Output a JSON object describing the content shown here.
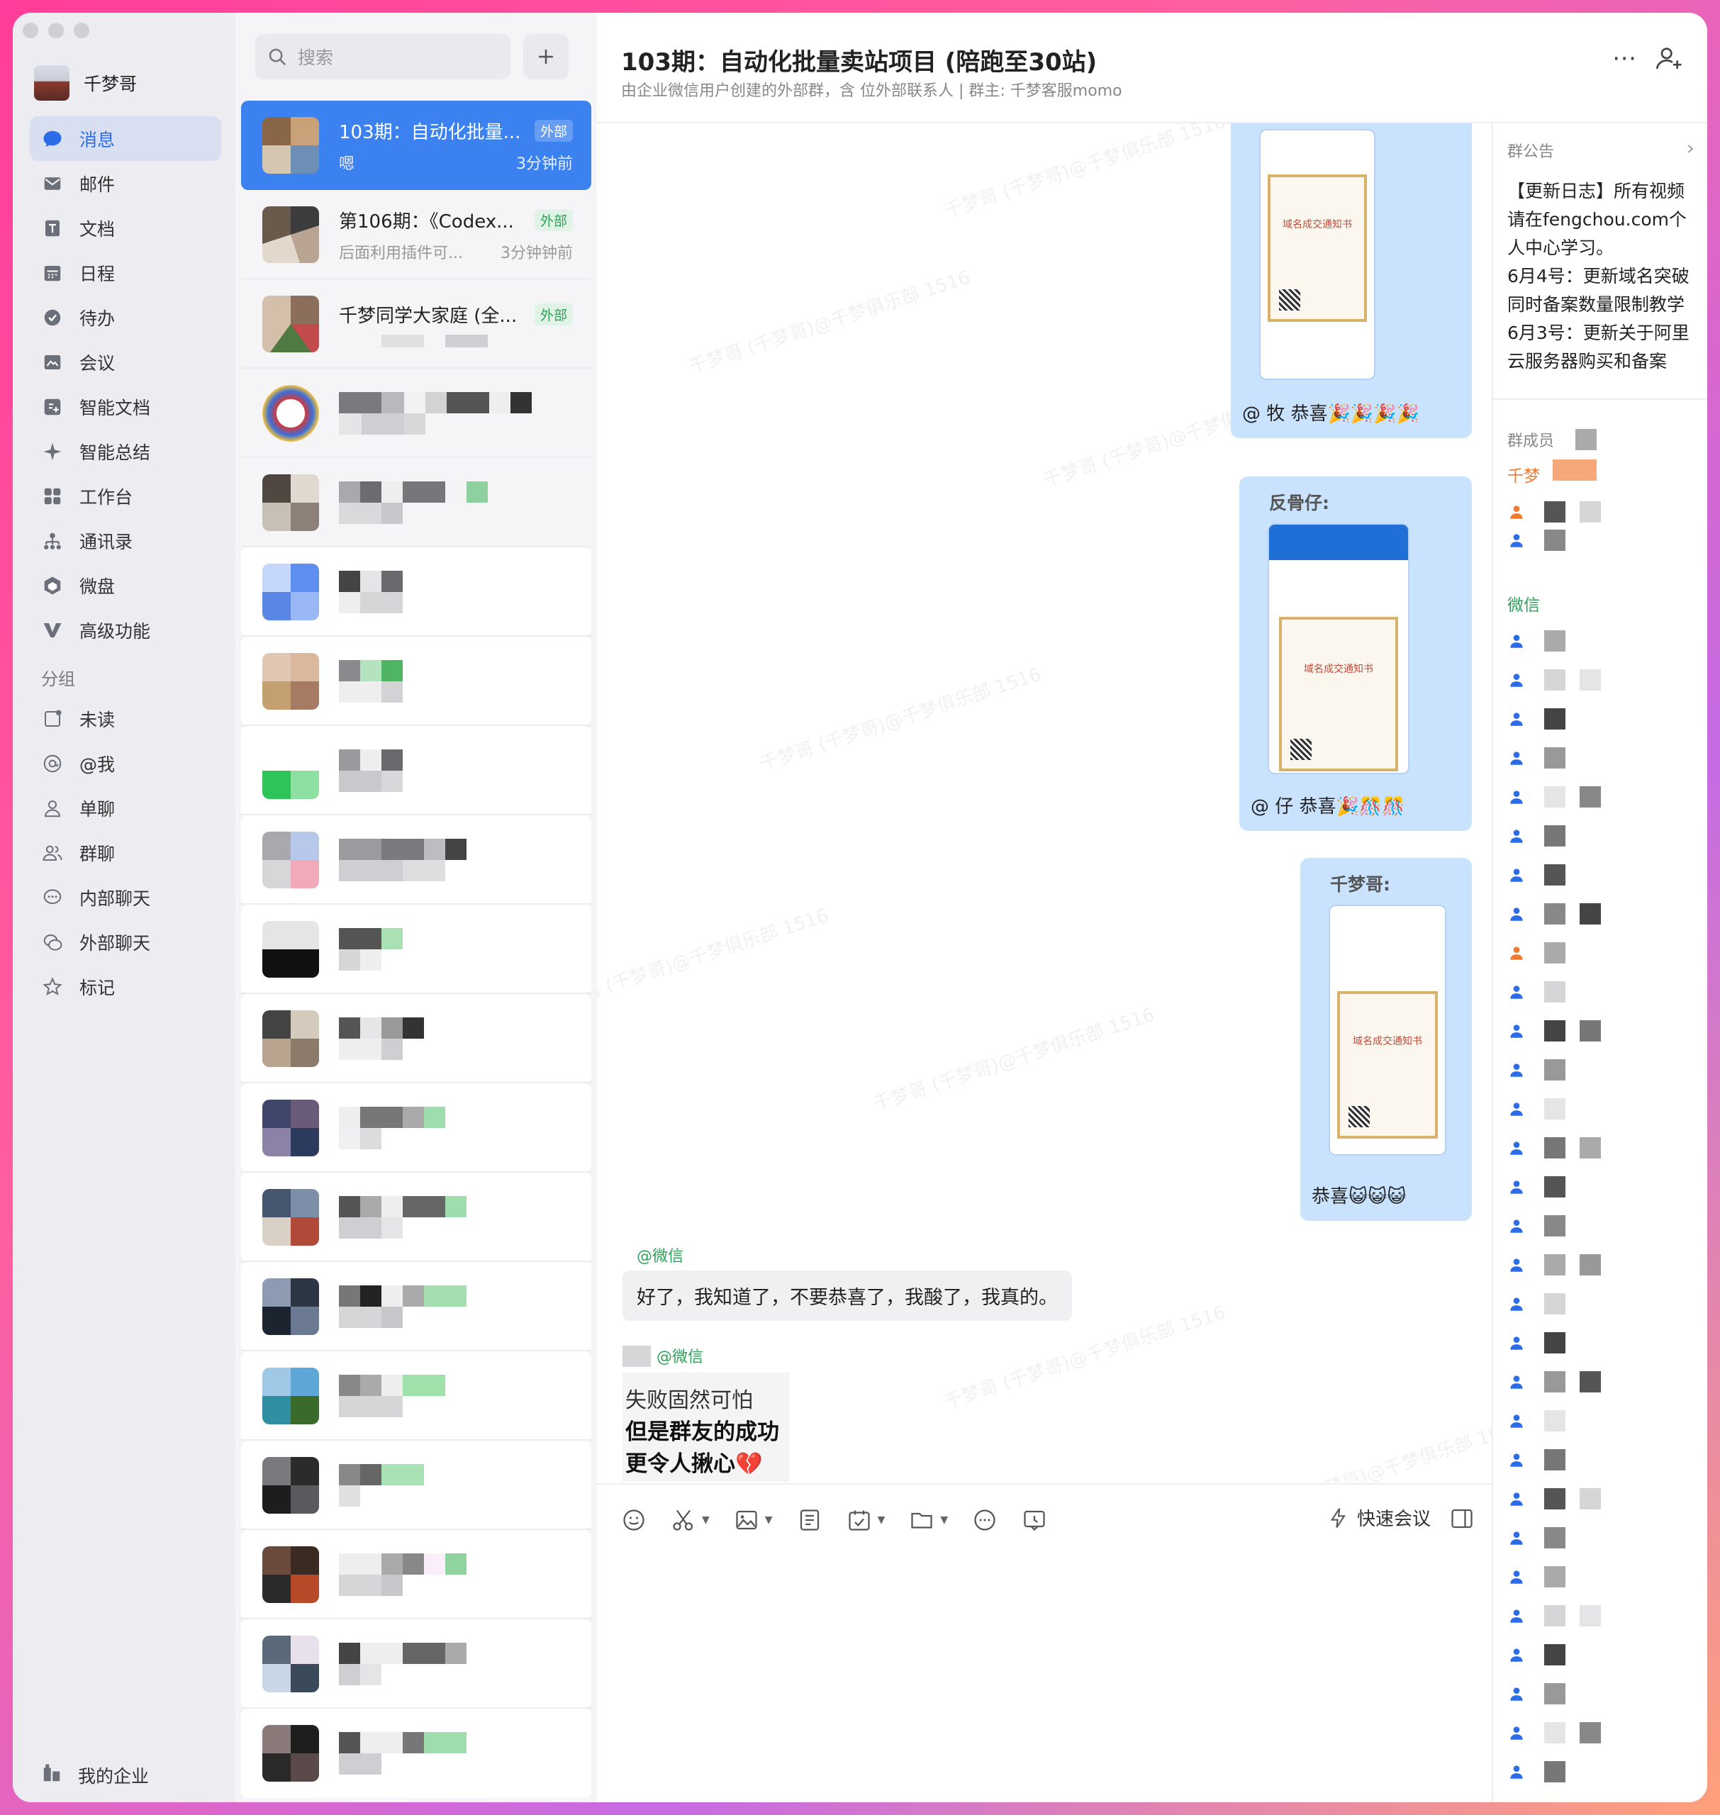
{
  "user": {
    "name": "千梦哥"
  },
  "nav": {
    "items": [
      {
        "label": "消息",
        "icon": "message-icon",
        "active": true
      },
      {
        "label": "邮件",
        "icon": "mail-icon"
      },
      {
        "label": "文档",
        "icon": "document-icon"
      },
      {
        "label": "日程",
        "icon": "calendar-icon"
      },
      {
        "label": "待办",
        "icon": "todo-icon"
      },
      {
        "label": "会议",
        "icon": "meeting-icon"
      },
      {
        "label": "智能文档",
        "icon": "smart-doc-icon"
      },
      {
        "label": "智能总结",
        "icon": "sparkle-icon"
      },
      {
        "label": "工作台",
        "icon": "workbench-icon"
      },
      {
        "label": "通讯录",
        "icon": "contacts-icon"
      },
      {
        "label": "微盘",
        "icon": "drive-icon"
      },
      {
        "label": "高级功能",
        "icon": "advanced-icon"
      }
    ],
    "group_label": "分组",
    "groups": [
      {
        "label": "未读",
        "icon": "unread-icon"
      },
      {
        "label": "@我",
        "icon": "at-icon"
      },
      {
        "label": "单聊",
        "icon": "single-chat-icon"
      },
      {
        "label": "群聊",
        "icon": "group-chat-icon"
      },
      {
        "label": "内部聊天",
        "icon": "internal-chat-icon"
      },
      {
        "label": "外部聊天",
        "icon": "external-chat-icon"
      },
      {
        "label": "标记",
        "icon": "star-icon"
      }
    ],
    "company_label": "我的企业"
  },
  "chatlist": {
    "search_placeholder": "搜索",
    "items": [
      {
        "title": "103期：自动化批量...",
        "tag": "外部",
        "preview": "嗯",
        "time": "3分钟前",
        "active": true
      },
      {
        "title": "第106期：《Codex...",
        "tag": "外部",
        "preview": "后面利用插件可...",
        "time": "3分钟钟前"
      },
      {
        "title": "千梦同学大家庭 (全...",
        "tag": "外部",
        "preview": "",
        "time": ""
      }
    ]
  },
  "chat": {
    "title": "103期：自动化批量卖站项目 (陪跑至30站)",
    "subtitle": "由企业微信用户创建的外部群，含 位外部联系人 | 群主: 千梦客服momo",
    "messages": {
      "m1_caption": "@ 牧 恭喜🎉🎉🎉🎉",
      "m2_sender": "反骨仔:",
      "m2_caption": "@ 仔 恭喜🎉🎊🎊",
      "m3_sender": "千梦哥:",
      "m3_caption": "恭喜😺😺😺",
      "cert_title": "域名成交通知书",
      "m4_sender": "@微信",
      "m4_text": "好了，我知道了，不要恭喜了，我酸了，我真的。",
      "m5_sender": "@微信",
      "m5_line1": "失败固然可怕",
      "m5_line2": "但是群友的成功",
      "m5_line3": "更令人揪心💔"
    },
    "watermark": "千梦哥 (千梦哥)@千梦俱乐部 1516",
    "quick_meeting": "快速会议"
  },
  "side": {
    "notice_header": "群公告",
    "notice_lines": [
      "【更新日志】所有视频请在fengchou.com个人中心学习。",
      "6月4号：更新域名突破同时备案数量限制教学",
      "6月3号：更新关于阿里云服务器购买和备案"
    ],
    "members_header": "群成员",
    "label_qianmeng": "千梦",
    "label_wechat": "微信",
    "colors": {
      "accent": "#3b82f0",
      "green": "#2fa05a",
      "orange": "#f07a2e"
    }
  }
}
